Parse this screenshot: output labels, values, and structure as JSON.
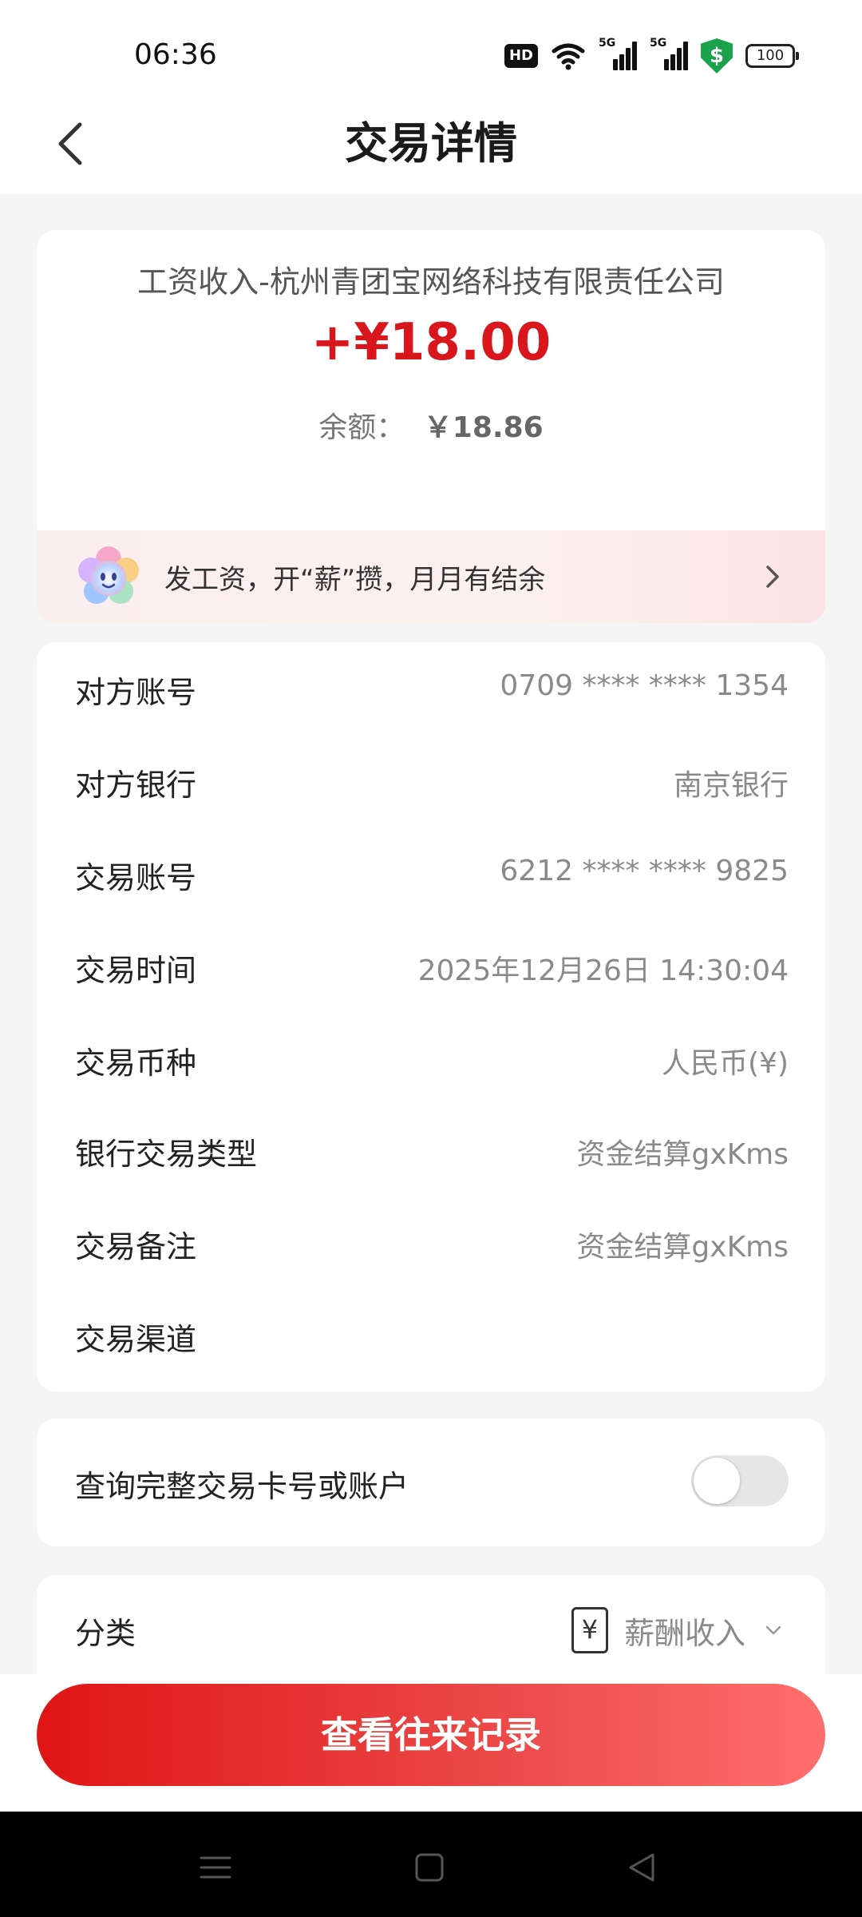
{
  "status_bar": {
    "time": "06:36",
    "hd_label": "HD",
    "network_1": "5G",
    "network_2": "5G",
    "shield_symbol": "$",
    "battery": "100"
  },
  "header": {
    "title": "交易详情",
    "back_icon": "chevron-left-icon"
  },
  "summary": {
    "counterparty": "工资收入-杭州青团宝网络科技有限责任公司",
    "amount": "+¥18.00",
    "balance_label": "余额：",
    "balance_value": "￥18.86",
    "amount_color": "#d9161c"
  },
  "promo": {
    "text": "发工资，开“薪”攒，月月有结余",
    "icon": "smiling-flower-icon"
  },
  "details": {
    "rows": [
      {
        "label": "对方账号",
        "value": "0709 **** **** 1354"
      },
      {
        "label": "对方银行",
        "value": "南京银行"
      },
      {
        "label": "交易账号",
        "value": "6212 **** **** 9825"
      },
      {
        "label": "交易时间",
        "value": "2025年12月26日 14:30:04"
      },
      {
        "label": "交易币种",
        "value": "人民币(¥)"
      },
      {
        "label": "银行交易类型",
        "value": "资金结算gxKms"
      },
      {
        "label": "交易备注",
        "value": "资金结算gxKms"
      },
      {
        "label": "交易渠道",
        "value": ""
      }
    ]
  },
  "toggle": {
    "label": "查询完整交易卡号或账户",
    "state": "off"
  },
  "category": {
    "label": "分类",
    "value": "薪酬收入",
    "icon_symbol": "¥"
  },
  "actions": {
    "view_history": "查看往来记录"
  },
  "colors": {
    "accent": "#e01515",
    "background": "#f5f5f5"
  }
}
